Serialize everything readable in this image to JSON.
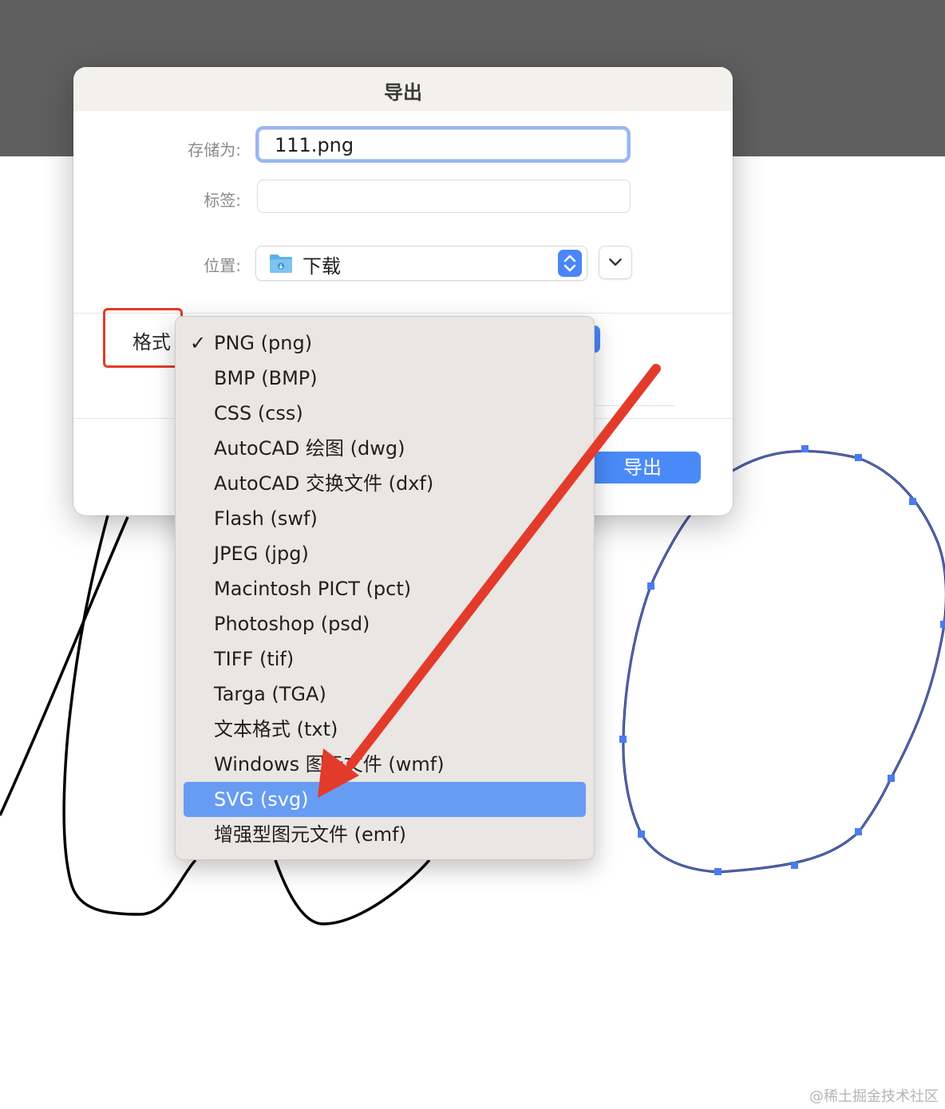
{
  "dialog": {
    "title": "导出",
    "save_as_label": "存储为:",
    "save_as_value": "111.png",
    "tags_label": "标签:",
    "tags_value": "",
    "location_label": "位置:",
    "location_value": "下载",
    "location_icon": "folder-icon",
    "format_label": "格式",
    "export_button": "导出"
  },
  "format_menu": {
    "items": [
      {
        "label": "PNG (png)",
        "checked": true
      },
      {
        "label": "BMP (BMP)"
      },
      {
        "label": "CSS (css)"
      },
      {
        "label": "AutoCAD 绘图 (dwg)"
      },
      {
        "label": "AutoCAD 交换文件 (dxf)"
      },
      {
        "label": "Flash (swf)"
      },
      {
        "label": "JPEG (jpg)"
      },
      {
        "label": "Macintosh PICT (pct)"
      },
      {
        "label": "Photoshop (psd)"
      },
      {
        "label": "TIFF (tif)"
      },
      {
        "label": "Targa (TGA)"
      },
      {
        "label": "文本格式 (txt)"
      },
      {
        "label": "Windows 图元文件 (wmf)"
      },
      {
        "label": "SVG (svg)",
        "highlighted": true
      },
      {
        "label": "增强型图元文件 (emf)"
      }
    ],
    "check_mark": "✓"
  },
  "colors": {
    "accent": "#4a8af8",
    "highlight": "#679cf3",
    "annotation_red": "#e33b2b"
  },
  "watermark": "@稀土掘金技术社区"
}
